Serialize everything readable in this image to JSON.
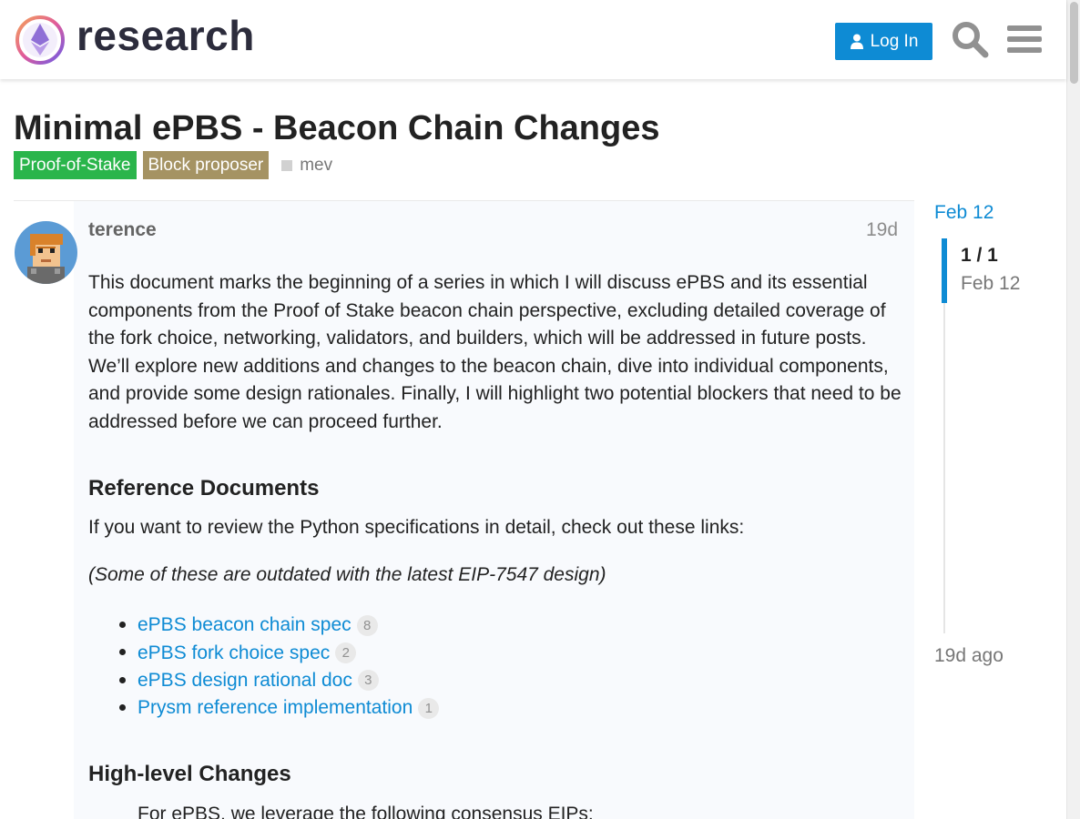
{
  "header": {
    "site_name": "research",
    "login_label": "Log In",
    "icons": [
      "ethereum-logo",
      "user-icon",
      "search-icon",
      "hamburger-menu-icon"
    ],
    "accent_color": "#0e8bd4"
  },
  "topic": {
    "title": "Minimal ePBS - Beacon Chain Changes",
    "categories": [
      {
        "label": "Proof-of-Stake",
        "color": "#2ab54b"
      },
      {
        "label": "Block proposer",
        "color": "#a59363"
      }
    ],
    "tags": [
      "mev"
    ]
  },
  "post": {
    "username": "terence",
    "date": "19d",
    "intro": "This document marks the beginning of a series in which I will discuss ePBS and its essential components from the Proof of Stake beacon chain perspective, excluding detailed coverage of the fork choice, networking, validators, and builders, which will be addressed in future posts. We’ll explore new additions and changes to the beacon chain, dive into individual components, and provide some design rationales. Finally, I will highlight two potential blockers that need to be addressed before we can proceed further.",
    "ref_heading": "Reference Documents",
    "ref_intro": "If you want to review the Python specifications in detail, check out these links:",
    "ref_note": "(Some of these are outdated with the latest EIP-7547 design)",
    "links": [
      {
        "label": "ePBS beacon chain spec",
        "count": "8"
      },
      {
        "label": "ePBS fork choice spec",
        "count": "2"
      },
      {
        "label": "ePBS design rational doc",
        "count": "3"
      },
      {
        "label": "Prysm reference implementation",
        "count": "1"
      }
    ],
    "changes_heading": "High-level Changes",
    "changes_intro": "For ePBS, we leverage the following consensus EIPs:"
  },
  "timeline": {
    "start_date": "Feb 12",
    "position": "1 / 1",
    "current_date": "Feb 12",
    "end_label": "19d ago"
  }
}
